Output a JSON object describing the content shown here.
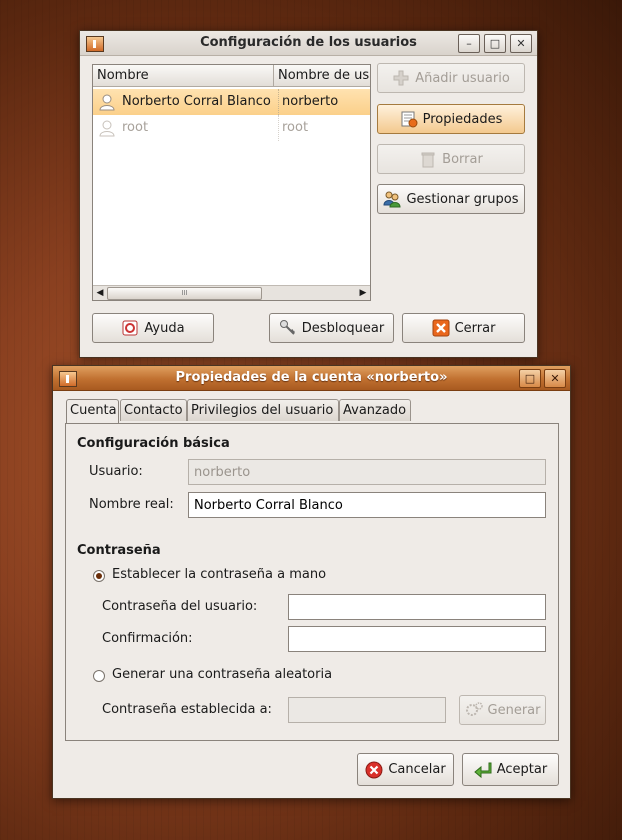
{
  "win1": {
    "title": "Configuración de los usuarios",
    "columns": [
      "Nombre",
      "Nombre de usu"
    ],
    "users": [
      {
        "name": "Norberto Corral Blanco",
        "login": "norberto"
      },
      {
        "name": "root",
        "login": "root"
      }
    ],
    "scroll_mid": "III",
    "buttons": {
      "add": "Añadir usuario",
      "props": "Propiedades",
      "delete": "Borrar",
      "groups": "Gestionar grupos",
      "help": "Ayuda",
      "unlock": "Desbloquear",
      "close": "Cerrar"
    }
  },
  "win2": {
    "title": "Propiedades de la cuenta «norberto»",
    "tabs": [
      "Cuenta",
      "Contacto",
      "Privilegios del usuario",
      "Avanzado"
    ],
    "section_basic": "Configuración básica",
    "label_user": "Usuario:",
    "user_value": "norberto",
    "label_realname": "Nombre real:",
    "realname_value": "Norberto Corral Blanco",
    "section_password": "Contraseña",
    "radio_manual": "Establecer la contraseña a mano",
    "label_userpass": "Contraseña del usuario:",
    "label_confirm": "Confirmación:",
    "radio_random": "Generar una contraseña aleatoria",
    "label_setto": "Contraseña establecida a:",
    "btn_generate": "Generar",
    "btn_cancel": "Cancelar",
    "btn_accept": "Aceptar"
  }
}
